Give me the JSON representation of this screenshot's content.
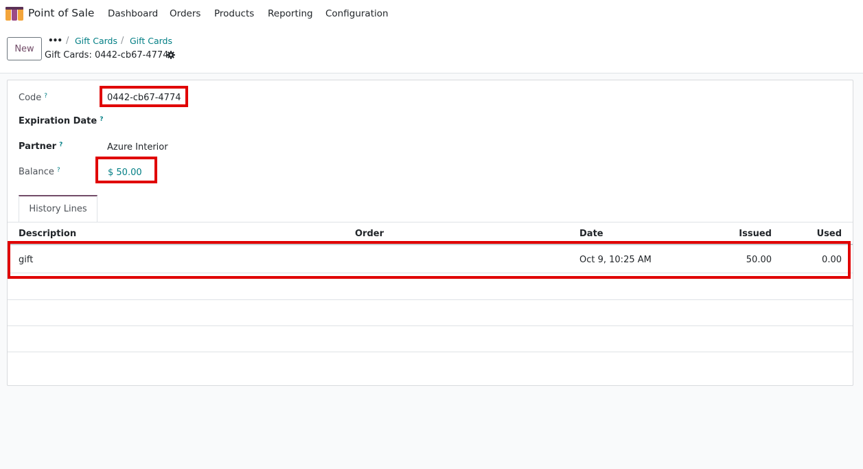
{
  "navbar": {
    "app_name": "Point of Sale",
    "menu": [
      "Dashboard",
      "Orders",
      "Products",
      "Reporting",
      "Configuration"
    ]
  },
  "control_panel": {
    "new_label": "New",
    "breadcrumb_more": "•••",
    "breadcrumbs": [
      "Gift Cards",
      "Gift Cards"
    ],
    "current": "Gift Cards: 0442-cb67-4774"
  },
  "form": {
    "code": {
      "label": "Code",
      "help": "?",
      "value": "0442-cb67-4774"
    },
    "expiration_date": {
      "label": "Expiration Date",
      "help": "?",
      "value": ""
    },
    "partner": {
      "label": "Partner",
      "help": "?",
      "value": "Azure Interior"
    },
    "balance": {
      "label": "Balance",
      "help": "?",
      "value": "$ 50.00"
    }
  },
  "tabs": [
    {
      "label": "History Lines",
      "active": true
    }
  ],
  "history": {
    "columns": [
      "Description",
      "Order",
      "Date",
      "Issued",
      "Used"
    ],
    "rows": [
      {
        "description": "gift",
        "order": "",
        "date": "Oct 9, 10:25 AM",
        "issued": "50.00",
        "used": "0.00"
      }
    ],
    "empty_rows": 3
  },
  "colors": {
    "brand": "#714b67",
    "link": "#017e84",
    "highlight": "#e00000"
  }
}
